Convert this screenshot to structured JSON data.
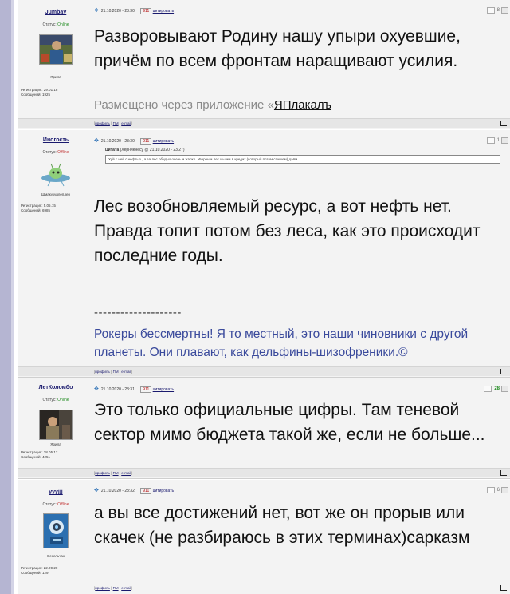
{
  "posts": [
    {
      "username": "Jumbay",
      "status_label": "Статус:",
      "status": "Online",
      "rank": "Ярила",
      "registered": "Регистрация: 29.01.18",
      "messages": "Сообщений: 1925",
      "date": "21.10.2020 - 23:30",
      "num": "911",
      "cite": "цитировать",
      "rating": "8",
      "text": "Разворовывают Родину нашу упыри охуевшие, причём по всем фронтам наращивают усилия.",
      "via_prefix": "Размещено через приложение «",
      "via_link": "ЯПлакалъ"
    },
    {
      "username": "Иногость",
      "status_label": "Статус:",
      "status": "Offline",
      "rank": "Шмакукуллеплер",
      "registered": "Регистрация: 5.05.15",
      "messages": "Сообщений: 6985",
      "date": "21.10.2020 - 23:30",
      "num": "911",
      "cite": "цитировать",
      "rating": "1",
      "quote_label": "Цитата",
      "quote_source": "(Херниенесу @ 21.10.2020 - 23:27)",
      "quote_text": "Хуй с ней с нефтью , а за лес обидно очень и жалко. Уверен и лес мы им в кредит (который потом спишем) даём",
      "text": "Лес возобновляемый ресурс, а вот нефть нет. Правда топит потом без леса, как это происходит последние годы.",
      "sig_line": "--------------------",
      "signature": "Рокеры бессмертны! Я то местный, это наши чиновники с другой планеты. Они плавают, как дельфины-шизофреники.©"
    },
    {
      "username": "ЛетКоломбо",
      "status_label": "Статус:",
      "status": "Online",
      "rank": "Ярила",
      "registered": "Регистрация: 28.05.12",
      "messages": "Сообщений: 4251",
      "date": "21.10.2020 - 23:31",
      "num": "911",
      "cite": "цитировать",
      "rating": "28",
      "text": "Это только официальные цифры. Там теневой сектор мимо бюджета такой же, если не больше..."
    },
    {
      "username": "yyyjjj",
      "status_label": "Статус:",
      "status": "Offline",
      "rank": "Весельчак",
      "registered": "Регистрация: 22.09.20",
      "messages": "Сообщений: 129",
      "date": "21.10.2020 - 23:32",
      "num": "911",
      "cite": "цитировать",
      "rating": "6",
      "text": "а вы все достижений нет, вот же он прорыв или скачек (не разбираюсь в этих терминах)сарказм"
    }
  ],
  "footer_links": {
    "profile": "профиль",
    "pm": "ПМ",
    "email": "e-mail"
  },
  "colors": {
    "online": "#1f8a1f",
    "offline": "#c03030",
    "signature": "#3a4a9c",
    "rating_positive": "#1f8a1f"
  }
}
